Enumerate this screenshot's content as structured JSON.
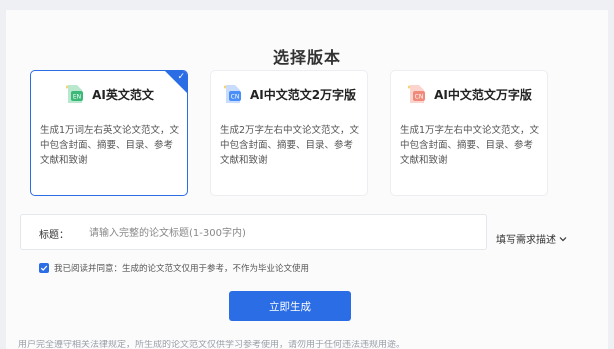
{
  "page_title": "选择版本",
  "versions": [
    {
      "name": "AI英文范文",
      "description": "生成1万词左右英文论文范文，文中包含封面、摘要、目录、参考文献和致谢",
      "selected": true,
      "icon": "en-doc-icon",
      "icon_color": "#3cb878"
    },
    {
      "name": "AI中文范文2万字版",
      "description": "生成2万字左右中文论文范文，文中包含封面、摘要、目录、参考文献和致谢",
      "selected": false,
      "icon": "cn-doc-icon",
      "icon_color": "#4a8ff7"
    },
    {
      "name": "AI中文范文万字版",
      "description": "生成1万字左右中文论文范文，文中包含封面、摘要、目录、参考文献和致谢",
      "selected": false,
      "icon": "cn-doc-icon",
      "icon_color": "#f08a7a"
    }
  ],
  "title_field": {
    "label": "标题：",
    "placeholder": "请输入完整的论文标题(1-300字内)",
    "value": ""
  },
  "fill_requirements_link": "填写需求描述",
  "agreement": {
    "checked": true,
    "text": "我已阅读并同意：生成的论文范文仅用于参考，不作为毕业论文使用"
  },
  "generate_button": "立即生成",
  "footer_partial_text": "用户完全遵守相关法律规定，所生成的论文范文仅供学习参考使用，请勿用于任何违法违规用途。"
}
